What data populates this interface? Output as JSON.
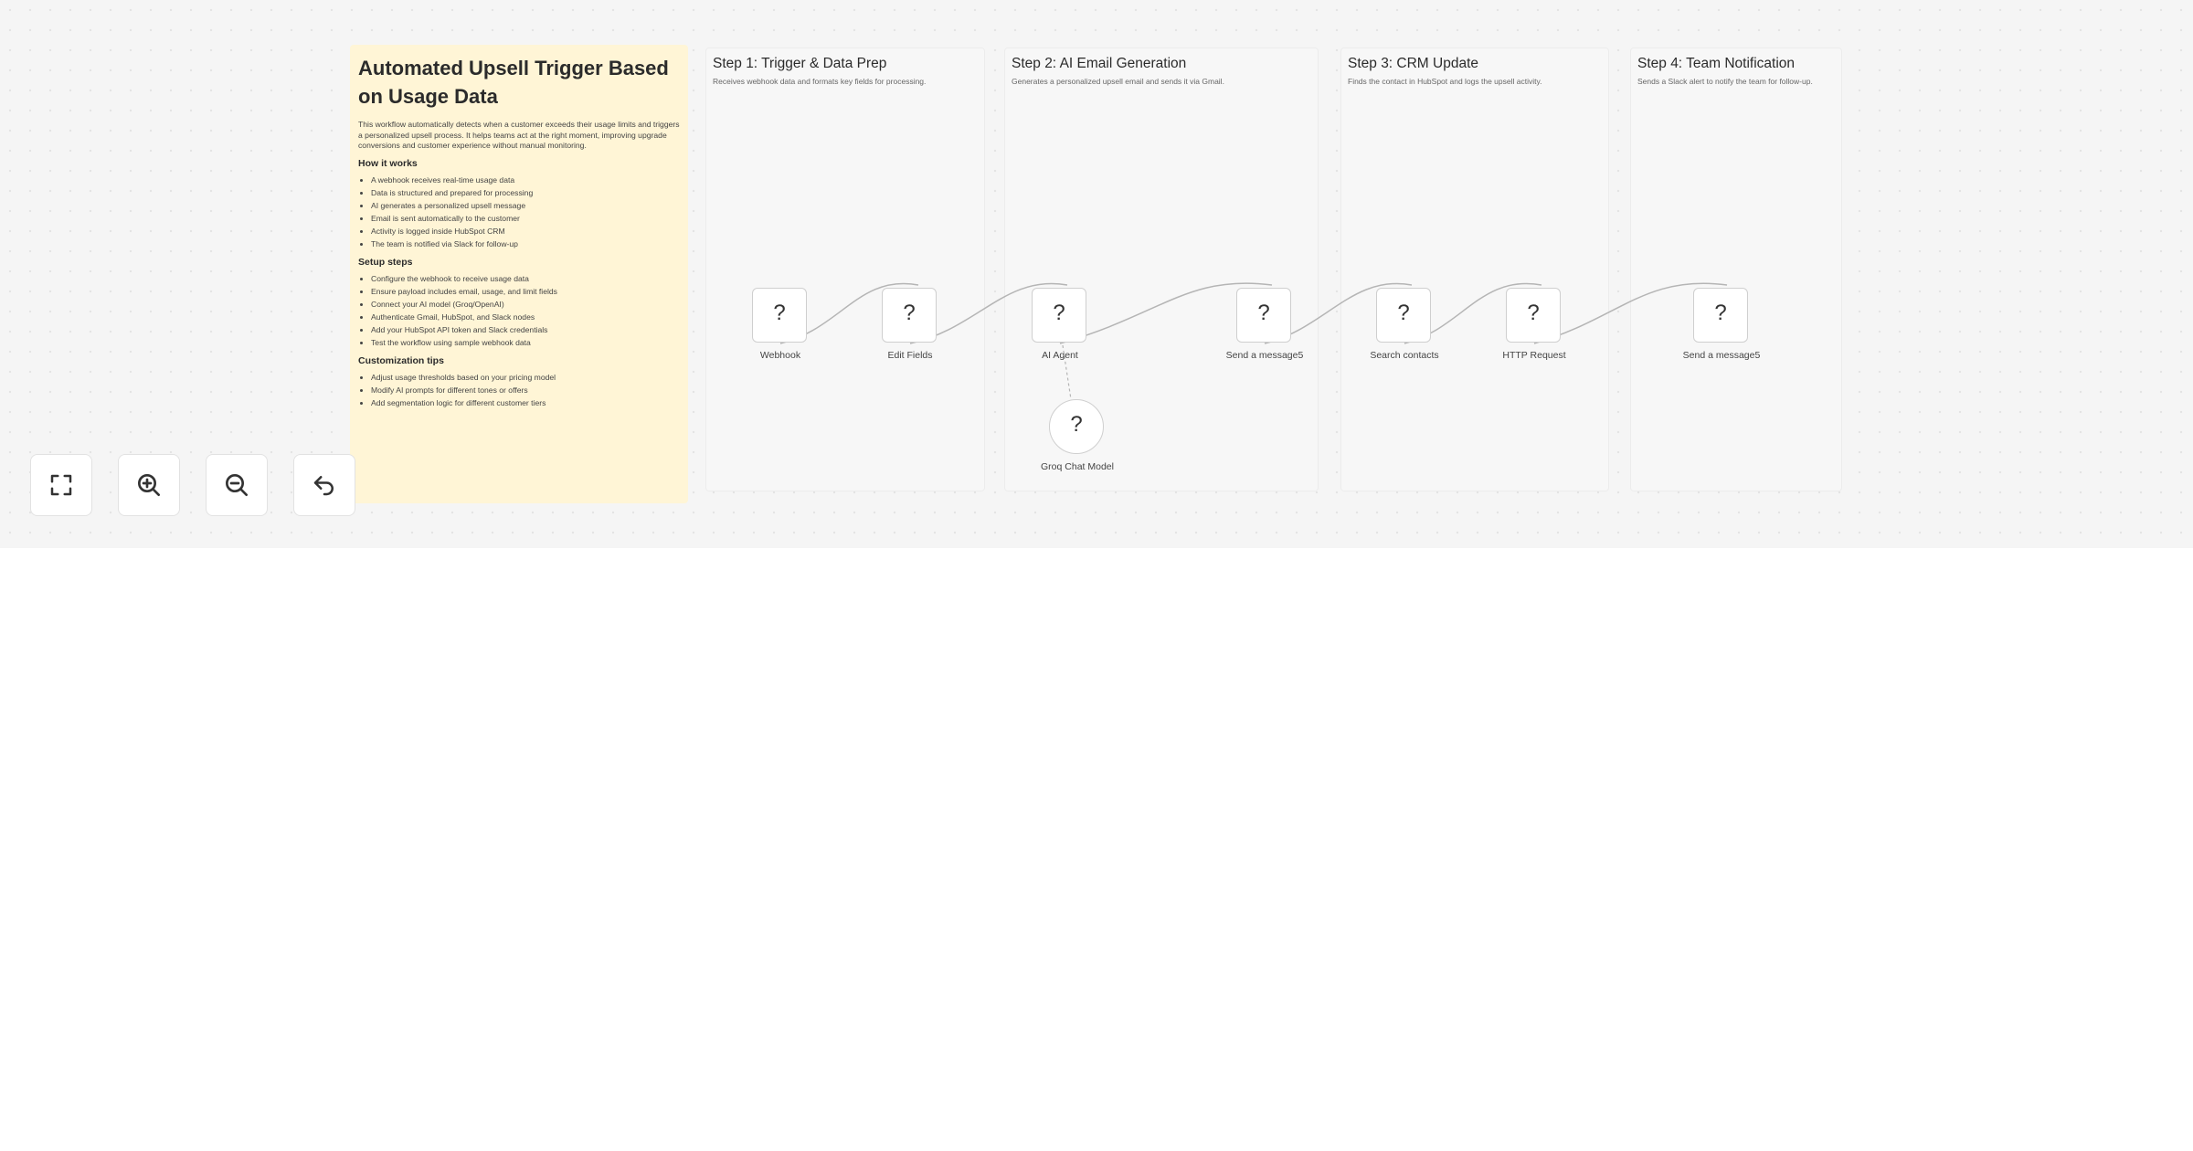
{
  "sticky_note": {
    "title": "Automated Upsell Trigger Based on Usage Data",
    "intro": "This workflow automatically detects when a customer exceeds their usage limits and triggers a personalized upsell process. It helps teams act at the right moment, improving upgrade conversions and customer experience without manual monitoring.",
    "how_heading": "How it works",
    "how_items": [
      "A webhook receives real-time usage data",
      "Data is structured and prepared for processing",
      "AI generates a personalized upsell message",
      "Email is sent automatically to the customer",
      "Activity is logged inside HubSpot CRM",
      "The team is notified via Slack for follow-up"
    ],
    "setup_heading": "Setup steps",
    "setup_items": [
      "Configure the webhook to receive usage data",
      "Ensure payload includes email, usage, and limit fields",
      "Connect your AI model (Groq/OpenAI)",
      "Authenticate Gmail, HubSpot, and Slack nodes",
      "Add your HubSpot API token and Slack credentials",
      "Test the workflow using sample webhook data"
    ],
    "tips_heading": "Customization tips",
    "tips_items": [
      "Adjust usage thresholds based on your pricing model",
      "Modify AI prompts for different tones or offers",
      "Add segmentation logic for different customer tiers"
    ]
  },
  "steps": [
    {
      "title": "Step 1: Trigger & Data Prep",
      "desc": "Receives webhook data and formats key fields for processing."
    },
    {
      "title": "Step 2: AI Email Generation",
      "desc": "Generates a personalized upsell email and sends it via Gmail."
    },
    {
      "title": "Step 3: CRM Update",
      "desc": "Finds the contact in HubSpot and logs the upsell activity."
    },
    {
      "title": "Step 4: Team Notification",
      "desc": "Sends a Slack alert to notify the team for follow-up."
    }
  ],
  "nodes": [
    {
      "label": "Webhook",
      "icon": "?"
    },
    {
      "label": "Edit Fields",
      "icon": "?"
    },
    {
      "label": "AI Agent",
      "icon": "?"
    },
    {
      "label": "Send a message5",
      "icon": "?"
    },
    {
      "label": "Search contacts",
      "icon": "?"
    },
    {
      "label": "HTTP Request",
      "icon": "?"
    },
    {
      "label": "Send a message5",
      "icon": "?"
    },
    {
      "label": "Groq Chat Model",
      "icon": "?"
    }
  ],
  "controls": [
    {
      "icon": "fit-view-icon"
    },
    {
      "icon": "zoom-in-icon"
    },
    {
      "icon": "zoom-out-icon"
    },
    {
      "icon": "undo-icon"
    }
  ],
  "colors": {
    "sticky_main": "#fff5d6",
    "canvas": "#f5f5f5",
    "wire": "#b5b5b5"
  }
}
